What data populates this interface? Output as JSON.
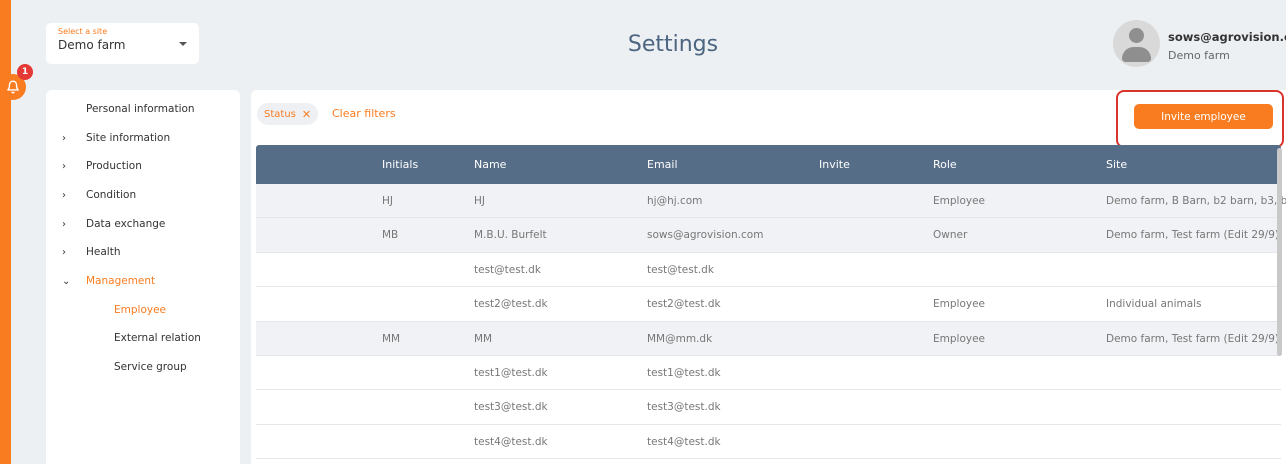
{
  "site_select": {
    "label": "Select a site",
    "value": "Demo farm"
  },
  "notifications": {
    "count": "1"
  },
  "page_title": "Settings",
  "user": {
    "email": "sows@agrovision.com",
    "site": "Demo farm"
  },
  "sidebar": {
    "items": [
      {
        "label": "Personal information",
        "chevron": ""
      },
      {
        "label": "Site information",
        "chevron": "›"
      },
      {
        "label": "Production",
        "chevron": "›"
      },
      {
        "label": "Condition",
        "chevron": "›"
      },
      {
        "label": "Data exchange",
        "chevron": "›"
      },
      {
        "label": "Health",
        "chevron": "›"
      },
      {
        "label": "Management",
        "chevron": "⌄"
      }
    ],
    "sub_items": [
      {
        "label": "Employee"
      },
      {
        "label": "External relation"
      },
      {
        "label": "Service group"
      }
    ]
  },
  "filters": {
    "chip_label": "Status",
    "chip_close": "✕",
    "clear_label": "Clear filters"
  },
  "invite_button": "Invite employee",
  "table": {
    "headers": {
      "initials": "Initials",
      "name": "Name",
      "email": "Email",
      "invite": "Invite",
      "role": "Role",
      "site": "Site"
    },
    "rows": [
      {
        "initials": "HJ",
        "name": "HJ",
        "email": "hj@hj.com",
        "role": "Employee",
        "site": "Demo farm, B Barn, b2 barn, b3, b"
      },
      {
        "initials": "MB",
        "name": "M.B.U. Burfelt",
        "email": "sows@agrovision.com",
        "role": "Owner",
        "site": "Demo farm, Test farm (Edit 29/9)"
      },
      {
        "initials": "",
        "name": "test@test.dk",
        "email": "test@test.dk",
        "role": "",
        "site": ""
      },
      {
        "initials": "",
        "name": "test2@test.dk",
        "email": "test2@test.dk",
        "role": "Employee",
        "site": "Individual animals"
      },
      {
        "initials": "MM",
        "name": "MM",
        "email": "MM@mm.dk",
        "role": "Employee",
        "site": "Demo farm, Test farm (Edit 29/9)"
      },
      {
        "initials": "",
        "name": "test1@test.dk",
        "email": "test1@test.dk",
        "role": "",
        "site": ""
      },
      {
        "initials": "",
        "name": "test3@test.dk",
        "email": "test3@test.dk",
        "role": "",
        "site": ""
      },
      {
        "initials": "",
        "name": "test4@test.dk",
        "email": "test4@test.dk",
        "role": "",
        "site": ""
      }
    ]
  },
  "colors": {
    "accent": "#f97c20",
    "header": "#566d87",
    "highlight": "#d9342b"
  }
}
